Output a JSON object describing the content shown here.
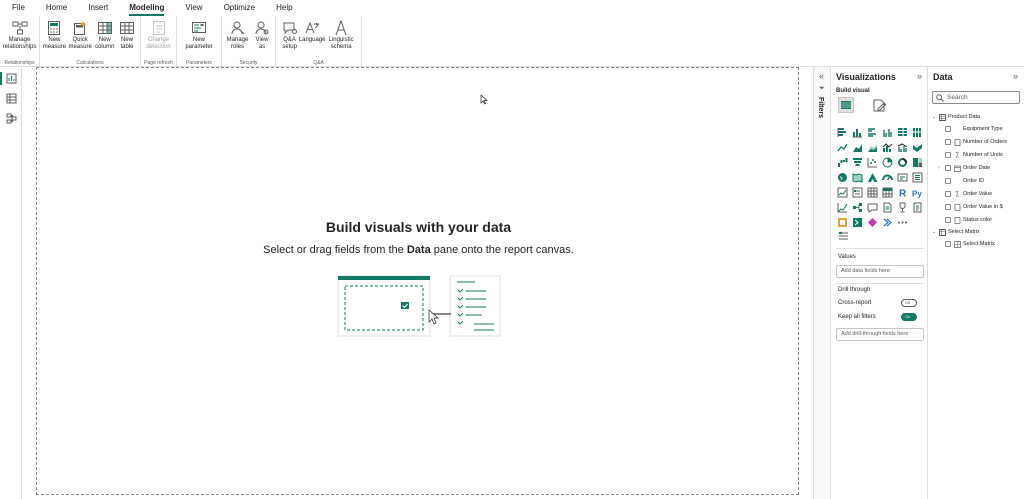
{
  "menu": [
    "File",
    "Home",
    "Insert",
    "Modeling",
    "View",
    "Optimize",
    "Help"
  ],
  "ribbon": {
    "groups": [
      {
        "label": "Relationships",
        "buttons": [
          {
            "label": "Manage relationships",
            "icon": "relationships-icon"
          }
        ]
      },
      {
        "label": "Calculations",
        "buttons": [
          {
            "label": "New measure",
            "icon": "calculator-icon"
          },
          {
            "label": "Quick measure",
            "icon": "quick-measure-icon"
          },
          {
            "label": "New column",
            "icon": "table-column-icon"
          },
          {
            "label": "New table",
            "icon": "table-icon"
          }
        ]
      },
      {
        "label": "Page refresh",
        "buttons": [
          {
            "label": "Change detection",
            "icon": "change-detection-icon",
            "disabled": true
          }
        ]
      },
      {
        "label": "Parameters",
        "buttons": [
          {
            "label": "New parameter",
            "icon": "parameter-icon"
          }
        ]
      },
      {
        "label": "Security",
        "buttons": [
          {
            "label": "Manage roles",
            "icon": "roles-icon"
          },
          {
            "label": "View as",
            "icon": "view-as-icon"
          }
        ]
      },
      {
        "label": "Q&A",
        "buttons": [
          {
            "label": "Q&A setup",
            "icon": "qa-setup-icon"
          },
          {
            "label": "Language",
            "icon": "language-icon"
          },
          {
            "label": "Linguistic schema",
            "icon": "linguistic-schema-icon"
          }
        ]
      }
    ]
  },
  "canvas": {
    "title": "Build visuals with your data",
    "subtitle_pre": "Select or drag fields from the ",
    "subtitle_bold": "Data",
    "subtitle_post": " pane onto the report canvas."
  },
  "filters": {
    "label": "Filters"
  },
  "visualizations": {
    "title": "Visualizations",
    "build_visual": "Build visual",
    "values_label": "Values",
    "values_placeholder": "Add data fields here",
    "drill_through": "Drill through",
    "cross_report": "Cross-report",
    "cross_report_state": "Off",
    "keep_all_filters": "Keep all filters",
    "keep_all_filters_state": "On",
    "drill_placeholder": "Add drill-through fields here"
  },
  "data": {
    "title": "Data",
    "search_placeholder": "Search",
    "tree": [
      {
        "label": "Product Data",
        "level": 0,
        "type": "table",
        "expanded": true
      },
      {
        "label": "Equipment Type",
        "level": 1,
        "type": "field"
      },
      {
        "label": "Number of Orders",
        "level": 1,
        "type": "field"
      },
      {
        "label": "Number of Units",
        "level": 1,
        "type": "sum"
      },
      {
        "label": "Order Date",
        "level": 1,
        "type": "date",
        "collapsed": true
      },
      {
        "label": "Order ID",
        "level": 1,
        "type": "field"
      },
      {
        "label": "Order Value",
        "level": 1,
        "type": "sum"
      },
      {
        "label": "Order Value in $",
        "level": 1,
        "type": "field"
      },
      {
        "label": "Status color",
        "level": 1,
        "type": "field"
      },
      {
        "label": "Select Matrix",
        "level": 0,
        "type": "table",
        "expanded": true
      },
      {
        "label": "Select Matrix",
        "level": 1,
        "type": "table-field"
      }
    ]
  },
  "colors": {
    "accent": "#117865",
    "border": "#e1dfdd",
    "text": "#252423"
  }
}
